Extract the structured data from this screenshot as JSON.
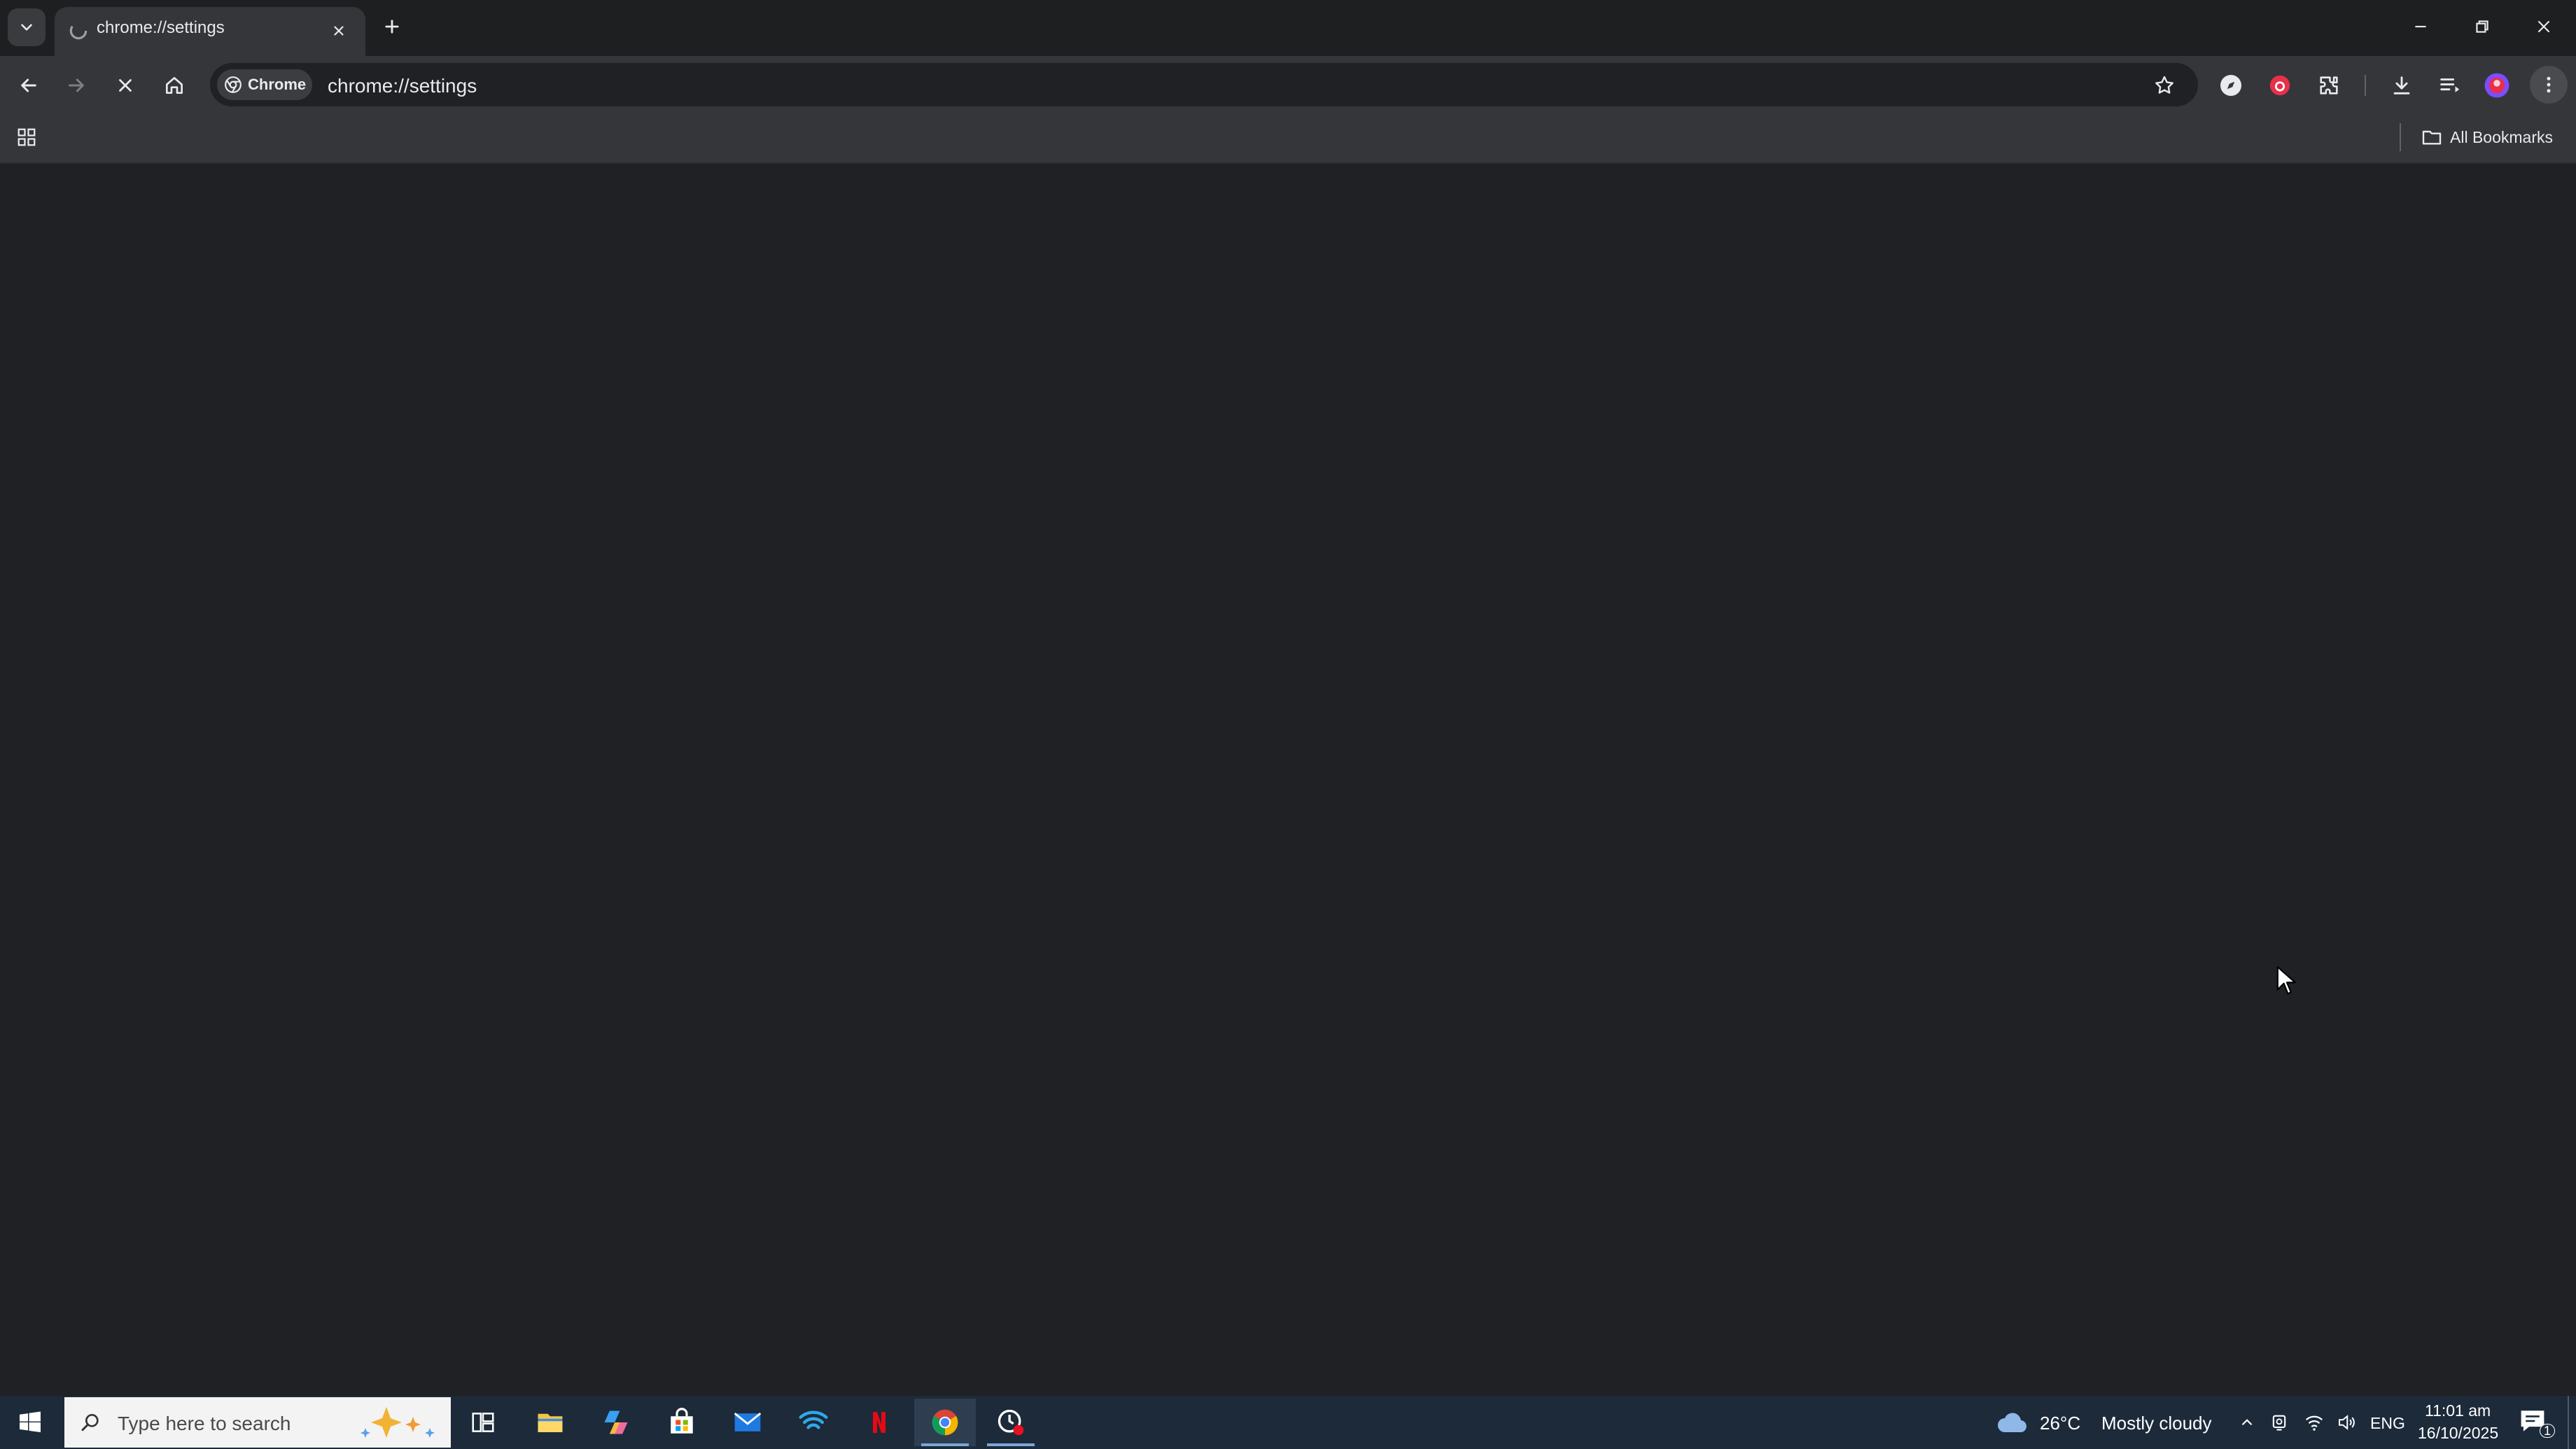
{
  "browser": {
    "tab": {
      "title": "chrome://settings"
    },
    "omnibox": {
      "chip_label": "Chrome",
      "url": "chrome://settings"
    },
    "bookmarks": {
      "all_bookmarks_label": "All Bookmarks"
    }
  },
  "taskbar": {
    "search_placeholder": "Type here to search",
    "weather": {
      "temperature": "26°C",
      "condition": "Mostly cloudy"
    },
    "language": "ENG",
    "time": "11:01 am",
    "date": "16/10/2025",
    "notification_count": "1"
  },
  "colors": {
    "page_background": "#202124",
    "toolbar": "#35363a",
    "tabstrip": "#1e1f21",
    "taskbar": "#1c2a3a",
    "accent_blue": "#4285f4",
    "extension_red": "#e8304a"
  }
}
